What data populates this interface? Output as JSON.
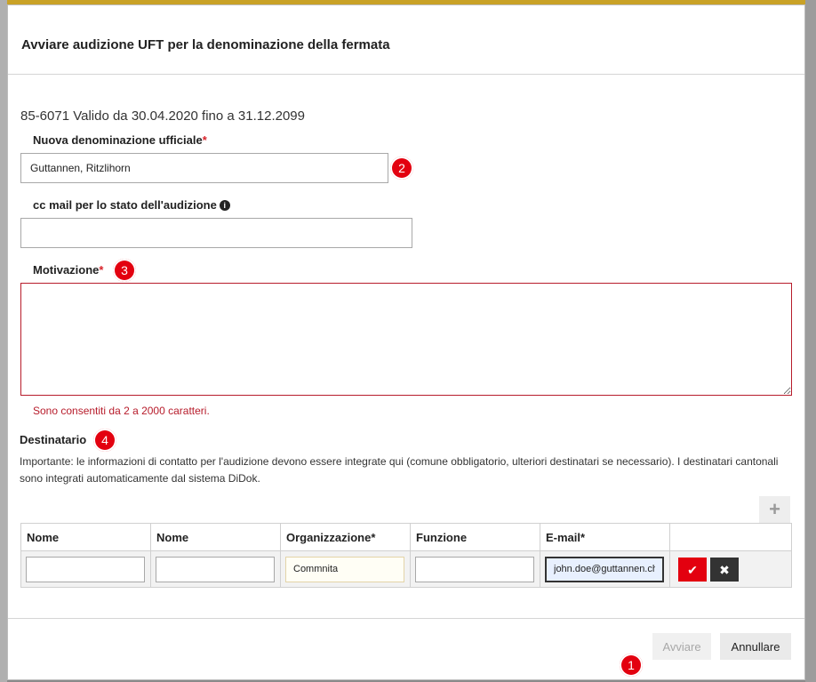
{
  "dialog": {
    "title": "Avviare audizione UFT per la denominazione della fermata",
    "validity": "85-6071 Valido da 30.04.2020 fino a 31.12.2099"
  },
  "form": {
    "new_name": {
      "label": "Nuova denominazione ufficiale",
      "required_mark": "*",
      "value": "Guttannen, Ritzlihorn"
    },
    "cc_mail": {
      "label": "cc mail per lo stato dell'audizione",
      "info_icon": "info-circle-icon",
      "value": ""
    },
    "motivation": {
      "label": "Motivazione",
      "required_mark": "*",
      "value": "",
      "error": "Sono consentiti da 2 a 2000 caratteri."
    }
  },
  "recipients": {
    "title": "Destinatario",
    "hint": "Importante: le informazioni di contatto per l'audizione devono essere integrate qui (comune obbligatorio, ulteriori destinatari se necessario). I destinatari cantonali sono integrati automaticamente dal sistema DiDok.",
    "add_icon": "plus-icon",
    "columns": [
      "Nome",
      "Nome",
      "Organizzazione*",
      "Funzione",
      "E-mail*",
      ""
    ],
    "row": {
      "first_name": "",
      "last_name": "",
      "organization": "Commnita",
      "function": "",
      "email": "john.doe@guttannen.ch"
    }
  },
  "badges": [
    "1",
    "2",
    "3",
    "4"
  ],
  "footer": {
    "start_label": "Avviare",
    "cancel_label": "Annullare"
  },
  "colors": {
    "accent": "#e3000f",
    "error": "#b71c2b",
    "dark_button": "#333333"
  }
}
